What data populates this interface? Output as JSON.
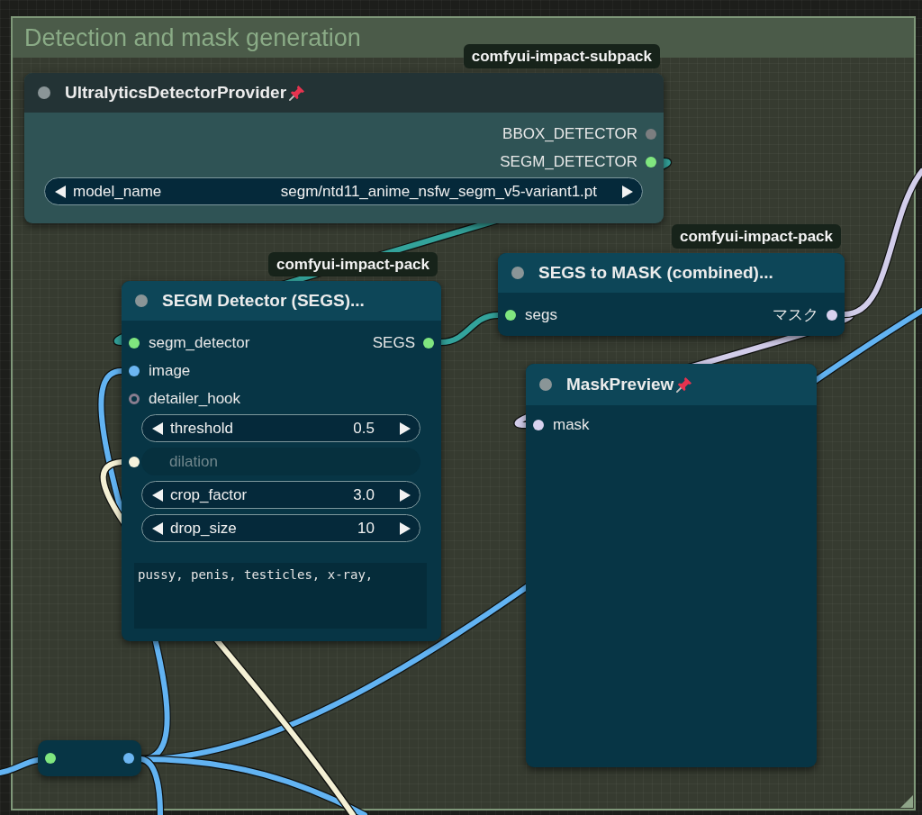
{
  "group": {
    "title": "Detection and mask generation"
  },
  "links": [
    {
      "color": "#33a39b"
    },
    {
      "color": "#33a39b"
    },
    {
      "color": "#d2cdea"
    },
    {
      "color": "#d2cdea"
    },
    {
      "color": "#62b3f2"
    },
    {
      "color": "#62b3f2"
    },
    {
      "color": "#62b3f2"
    },
    {
      "color": "#62b3f2"
    },
    {
      "color": "#62b3f2"
    },
    {
      "color": "#f4f0d4"
    }
  ],
  "nodes": [
    {
      "kind": "node",
      "source": "comfyui-impact-subpack",
      "title": "UltralyticsDetectorProvider",
      "pinned": true,
      "color": "#233335",
      "body": {
        "color": "#2f5355"
      },
      "outputs": [
        {
          "label": "BBOX_DETECTOR",
          "kind": "dot",
          "color": "#7c7e80"
        },
        {
          "label": "SEGM_DETECTOR",
          "kind": "dot",
          "color": "#80e67f"
        }
      ],
      "widgets": [
        {
          "kind": "combo",
          "label": "model_name",
          "value": "segm/ntd11_anime_nsfw_segm_v5-variant1.pt"
        }
      ]
    },
    {
      "kind": "node",
      "source": "comfyui-impact-pack",
      "title": "SEGM Detector (SEGS)...",
      "pinned": false,
      "color": "#0d4658",
      "body": {
        "color": "#073545"
      },
      "inputs": [
        {
          "label": "segm_detector",
          "kind": "dot",
          "color": "#80e67f"
        },
        {
          "label": "image",
          "kind": "dot",
          "color": "#6cb6f2"
        },
        {
          "label": "detailer_hook",
          "kind": "ring",
          "color": "#8a7d8f"
        }
      ],
      "outputs": [
        {
          "label": "SEGS",
          "kind": "dot",
          "color": "#80e67f"
        }
      ],
      "widgets": [
        {
          "kind": "number",
          "label": "threshold",
          "value": "0.5"
        },
        {
          "kind": "converted",
          "label": "dilation",
          "color": "#f6f2dc"
        },
        {
          "kind": "number",
          "label": "crop_factor",
          "value": "3.0"
        },
        {
          "kind": "number",
          "label": "drop_size",
          "value": "10"
        },
        {
          "kind": "text",
          "value": "pussy, penis, testicles, x-ray,"
        }
      ]
    },
    {
      "kind": "node",
      "source": "comfyui-impact-pack",
      "title": "SEGS to MASK (combined)...",
      "pinned": false,
      "color": "#0d4658",
      "body": {
        "color": "#073545"
      },
      "inputs": [
        {
          "label": "segs",
          "kind": "dot",
          "color": "#80e67f"
        }
      ],
      "outputs": [
        {
          "label": "マスク",
          "kind": "dot",
          "color": "#d8d2ef"
        }
      ]
    },
    {
      "kind": "node",
      "title": "MaskPreview",
      "pinned": true,
      "color": "#0d4658",
      "body": {
        "color": "#073545"
      },
      "inputs": [
        {
          "label": "mask",
          "kind": "dot",
          "color": "#d8d2ef"
        }
      ]
    },
    {
      "kind": "reroute",
      "body": {
        "color": "#073545"
      },
      "inputs": [
        {
          "kind": "dot",
          "color": "#80e67f"
        }
      ],
      "outputs": [
        {
          "kind": "dot",
          "color": "#6cb6f2"
        }
      ]
    }
  ]
}
